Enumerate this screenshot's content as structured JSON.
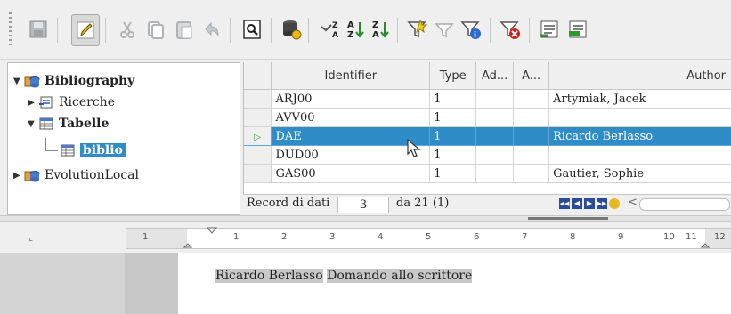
{
  "toolbar": {
    "buttons": [
      {
        "icon": "save-icon"
      },
      {
        "icon": "edit-icon"
      },
      {
        "icon": "cut-icon"
      },
      {
        "icon": "copy-icon"
      },
      {
        "icon": "paste-icon"
      },
      {
        "icon": "undo-icon"
      },
      {
        "icon": "find-record-icon"
      },
      {
        "icon": "data-source-icon"
      },
      {
        "icon": "data-to-text-icon"
      },
      {
        "icon": "sort-ascending-icon"
      },
      {
        "icon": "sort-descending-icon"
      },
      {
        "icon": "autofilter-icon"
      },
      {
        "icon": "standard-filter-icon"
      },
      {
        "icon": "apply-filter-icon"
      },
      {
        "icon": "remove-filter-icon"
      },
      {
        "icon": "data-to-fields-icon"
      },
      {
        "icon": "data-to-text-2-icon"
      }
    ]
  },
  "tree": {
    "root": "Bibliography",
    "queries": "Ricerche",
    "tables": "Tabelle",
    "selected_table": "biblio",
    "other": "EvolutionLocal"
  },
  "grid": {
    "columns": [
      "Identifier",
      "Type",
      "Ad...",
      "A...",
      "Author"
    ],
    "rows": [
      {
        "id": "ARJ00",
        "type": "1",
        "ad": "",
        "a": "",
        "author": "Artymiak, Jacek"
      },
      {
        "id": "AVV00",
        "type": "1",
        "ad": "",
        "a": "",
        "author": ""
      },
      {
        "id": "DAE",
        "type": "1",
        "ad": "",
        "a": "",
        "author": "Ricardo Berlasso"
      },
      {
        "id": "DUD00",
        "type": "1",
        "ad": "",
        "a": "",
        "author": ""
      },
      {
        "id": "GAS00",
        "type": "1",
        "ad": "",
        "a": "",
        "author": "Gautier, Sophie"
      }
    ],
    "selected_index": 2
  },
  "navigation": {
    "record_label": "Record di dati",
    "record_number": "3",
    "of_label": "da 21 (1)"
  },
  "ruler": {
    "labels": [
      "1",
      "1",
      "2",
      "3",
      "4",
      "5",
      "6",
      "7",
      "8",
      "9",
      "10",
      "11",
      "12"
    ]
  },
  "document": {
    "field_author": "Ricardo Berlasso",
    "field_title": "Domando allo scrittore"
  },
  "colors": {
    "selection": "#308cc6",
    "field_shading": "#c8c8c8"
  }
}
